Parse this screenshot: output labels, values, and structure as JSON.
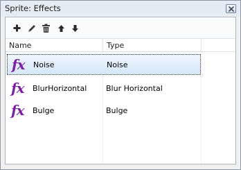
{
  "window": {
    "title": "Sprite: Effects"
  },
  "toolbar": {
    "buttons": [
      {
        "icon": "plus-icon"
      },
      {
        "icon": "pencil-icon"
      },
      {
        "icon": "trash-icon"
      },
      {
        "icon": "arrow-up-icon"
      },
      {
        "icon": "arrow-down-icon"
      }
    ]
  },
  "table": {
    "columns": [
      "Name",
      "Type"
    ],
    "rows": [
      {
        "icon_text": "fx",
        "name": "Noise",
        "type": "Noise",
        "selected": true
      },
      {
        "icon_text": "fx",
        "name": "BlurHorizontal",
        "type": "Blur Horizontal",
        "selected": false
      },
      {
        "icon_text": "fx",
        "name": "Bulge",
        "type": "Bulge",
        "selected": false
      }
    ]
  },
  "colors": {
    "fx_icon": "#7b1fa2",
    "selection": "#d4e6fb"
  }
}
